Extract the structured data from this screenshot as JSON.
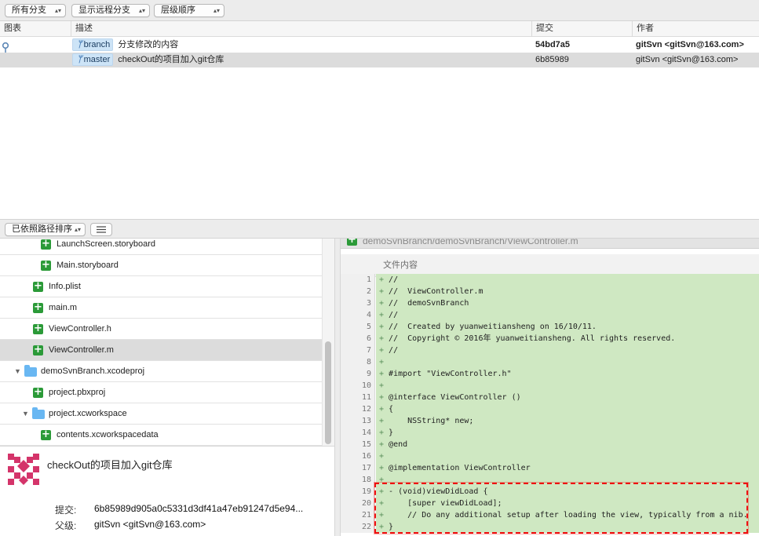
{
  "toolbar": {
    "branches_dropdown": "所有分支",
    "remote_dropdown": "显示远程分支",
    "order_dropdown": "层级顺序"
  },
  "commit_table": {
    "columns": {
      "graph": "图表",
      "description": "描述",
      "commit": "提交",
      "author": "作者"
    },
    "rows": [
      {
        "branch_tag": "branch",
        "message": "分支修改的内容",
        "hash": "54bd7a5",
        "author": "gitSvn <gitSvn@163.com>",
        "selected": false
      },
      {
        "branch_tag": "master",
        "message": "checkOut的项目加入git仓库",
        "hash": "6b85989",
        "author": "gitSvn <gitSvn@163.com>",
        "selected": true
      }
    ]
  },
  "file_list": {
    "sort_dropdown": "已依照路径排序",
    "items": [
      {
        "name": "LaunchScreen.storyboard",
        "kind": "file-added"
      },
      {
        "name": "Main.storyboard",
        "kind": "file-added"
      },
      {
        "name": "Info.plist",
        "kind": "file-added"
      },
      {
        "name": "main.m",
        "kind": "file-added"
      },
      {
        "name": "ViewController.h",
        "kind": "file-added"
      },
      {
        "name": "ViewController.m",
        "kind": "file-added",
        "selected": true
      },
      {
        "name": "demoSvnBranch.xcodeproj",
        "kind": "folder"
      },
      {
        "name": "project.pbxproj",
        "kind": "file-added"
      },
      {
        "name": "project.xcworkspace",
        "kind": "folder"
      },
      {
        "name": "contents.xcworkspacedata",
        "kind": "file-added"
      }
    ]
  },
  "details": {
    "title": "checkOut的项目加入git仓库",
    "commit_label": "提交:",
    "commit_value": "6b85989d905a0c5331d3df41a47eb91247d5e94...",
    "parent_label": "父级:",
    "parent_value": "gitSvn <gitSvn@163.com>"
  },
  "diff": {
    "file_path": "demoSvnBranch/demoSvnBranch/ViewController.m",
    "hunk_header": "文件内容",
    "lines": [
      {
        "n": "1",
        "marker": "+",
        "text": " //"
      },
      {
        "n": "2",
        "marker": "+",
        "text": " //  ViewController.m"
      },
      {
        "n": "3",
        "marker": "+",
        "text": " //  demoSvnBranch"
      },
      {
        "n": "4",
        "marker": "+",
        "text": " //"
      },
      {
        "n": "5",
        "marker": "+",
        "text": " //  Created by yuanweitiansheng on 16/10/11."
      },
      {
        "n": "6",
        "marker": "+",
        "text": " //  Copyright © 2016年 yuanweitiansheng. All rights reserved."
      },
      {
        "n": "7",
        "marker": "+",
        "text": " //"
      },
      {
        "n": "8",
        "marker": "+",
        "text": ""
      },
      {
        "n": "9",
        "marker": "+",
        "text": " #import \"ViewController.h\""
      },
      {
        "n": "10",
        "marker": "+",
        "text": ""
      },
      {
        "n": "11",
        "marker": "+",
        "text": " @interface ViewController ()"
      },
      {
        "n": "12",
        "marker": "+",
        "text": " {"
      },
      {
        "n": "13",
        "marker": "+",
        "text": "     NSString* new;"
      },
      {
        "n": "14",
        "marker": "+",
        "text": " }"
      },
      {
        "n": "15",
        "marker": "+",
        "text": " @end"
      },
      {
        "n": "16",
        "marker": "+",
        "text": ""
      },
      {
        "n": "17",
        "marker": "+",
        "text": " @implementation ViewController"
      },
      {
        "n": "18",
        "marker": "+",
        "text": ""
      },
      {
        "n": "19",
        "marker": "+",
        "text": " - (void)viewDidLoad {"
      },
      {
        "n": "20",
        "marker": "+",
        "text": "     [super viewDidLoad];"
      },
      {
        "n": "21",
        "marker": "+",
        "text": "     // Do any additional setup after loading the view, typically from a nib."
      },
      {
        "n": "22",
        "marker": "+",
        "text": " }"
      }
    ]
  },
  "colors": {
    "added_bg": "#cfe8c2",
    "added_icon": "#2b9a38",
    "selection": "#dcdcdc",
    "branch_tag": "#cde4f7",
    "annotation": "#ee1111"
  }
}
